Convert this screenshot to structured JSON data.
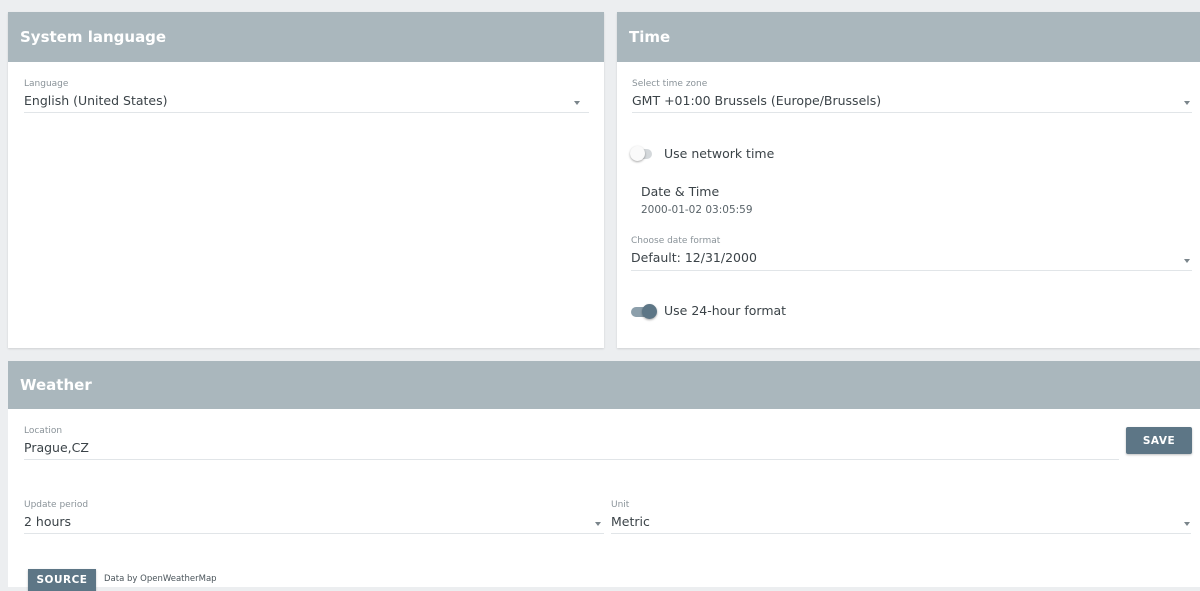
{
  "system_language": {
    "title": "System language",
    "language_label": "Language",
    "language_value": "English (United States)"
  },
  "time": {
    "title": "Time",
    "timezone_label": "Select time zone",
    "timezone_value": "GMT +01:00 Brussels (Europe/Brussels)",
    "network_time_label": "Use network time",
    "network_time_on": false,
    "datetime_title": "Date & Time",
    "datetime_value": "2000-01-02 03:05:59",
    "date_format_label": "Choose date format",
    "date_format_value": "Default: 12/31/2000",
    "hour24_label": "Use 24-hour format",
    "hour24_on": true
  },
  "weather": {
    "title": "Weather",
    "location_label": "Location",
    "location_value": "Prague,CZ",
    "save_label": "SAVE",
    "update_period_label": "Update period",
    "update_period_value": "2 hours",
    "unit_label": "Unit",
    "unit_value": "Metric",
    "source_label": "SOURCE",
    "source_note": "Data by OpenWeatherMap"
  },
  "colors": {
    "header": "#aab7bd",
    "button": "#5d7686",
    "toggle_on": "#5d7686",
    "toggle_off": "#d4d8db"
  }
}
